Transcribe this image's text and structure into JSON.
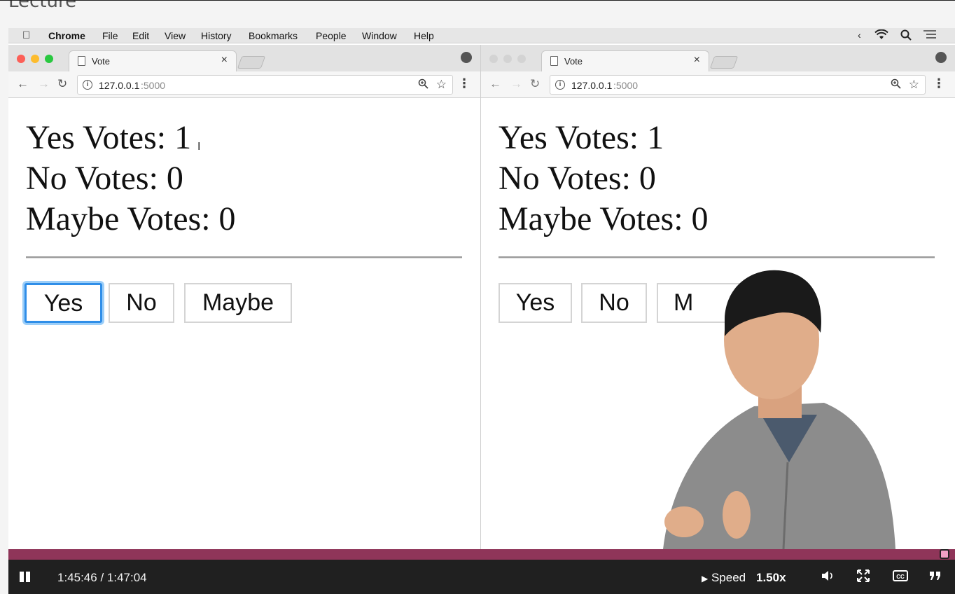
{
  "page": {
    "heading": "Lecture"
  },
  "menubar": {
    "app": "Chrome",
    "items": [
      "File",
      "Edit",
      "View",
      "History",
      "Bookmarks",
      "People",
      "Window",
      "Help"
    ]
  },
  "browsers": [
    {
      "tab_title": "Vote",
      "url_host": "127.0.0.1",
      "url_port": ":5000",
      "tallies": [
        "Yes Votes: 1",
        "No Votes: 0",
        "Maybe Votes: 0"
      ],
      "buttons": [
        "Yes",
        "No",
        "Maybe"
      ],
      "focused_button": "Yes"
    },
    {
      "tab_title": "Vote",
      "url_host": "127.0.0.1",
      "url_port": ":5000",
      "tallies": [
        "Yes Votes: 1",
        "No Votes: 0",
        "Maybe Votes: 0"
      ],
      "buttons": [
        "Yes",
        "No",
        "M"
      ]
    }
  ],
  "player": {
    "current_time": "1:45:46",
    "duration": "1:47:04",
    "time_display": "1:45:46 / 1:47:04",
    "speed_label": "Speed",
    "speed_value": "1.50x",
    "progress_fraction": 0.988,
    "progress_color": "#8f3559",
    "icons": [
      "pause-icon",
      "volume-icon",
      "fullscreen-icon",
      "captions-icon",
      "transcript-icon"
    ]
  },
  "colors": {
    "focus_ring": "#2f8ee8",
    "close_light": "#fc5f57",
    "minimize_light": "#fdbc2e",
    "zoom_light": "#29c840"
  }
}
